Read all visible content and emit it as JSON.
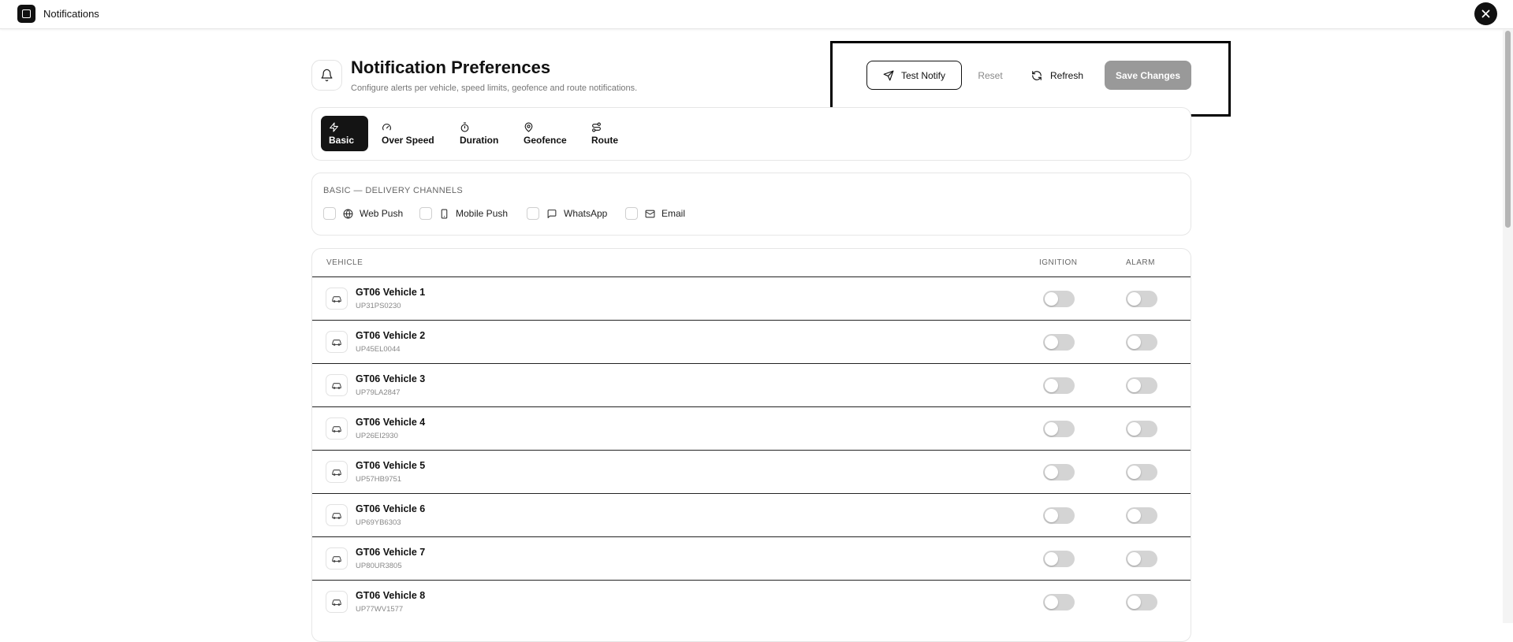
{
  "window": {
    "title": "Notifications"
  },
  "header": {
    "title": "Notification Preferences",
    "subtitle": "Configure alerts per vehicle, speed limits, geofence and route notifications."
  },
  "actions": {
    "test_notify": "Test Notify",
    "reset": "Reset",
    "refresh": "Refresh",
    "save": "Save Changes"
  },
  "tabs": [
    {
      "label": "Basic",
      "icon": "lightning-icon",
      "active": true
    },
    {
      "label": "Over Speed",
      "icon": "speedometer-icon",
      "active": false
    },
    {
      "label": "Duration",
      "icon": "stopwatch-icon",
      "active": false
    },
    {
      "label": "Geofence",
      "icon": "map-pin-icon",
      "active": false
    },
    {
      "label": "Route",
      "icon": "route-icon",
      "active": false
    }
  ],
  "channels": {
    "title": "BASIC — DELIVERY CHANNELS",
    "items": [
      {
        "label": "Web Push",
        "icon": "globe-icon",
        "checked": false
      },
      {
        "label": "Mobile Push",
        "icon": "phone-icon",
        "checked": false
      },
      {
        "label": "WhatsApp",
        "icon": "chat-icon",
        "checked": false
      },
      {
        "label": "Email",
        "icon": "mail-icon",
        "checked": false
      }
    ]
  },
  "table": {
    "headers": {
      "vehicle": "VEHICLE",
      "ignition": "IGNITION",
      "alarm": "ALARM"
    },
    "rows": [
      {
        "name": "GT06 Vehicle 1",
        "plate": "UP31PS0230",
        "ignition": false,
        "alarm": false
      },
      {
        "name": "GT06 Vehicle 2",
        "plate": "UP45EL0044",
        "ignition": false,
        "alarm": false
      },
      {
        "name": "GT06 Vehicle 3",
        "plate": "UP79LA2847",
        "ignition": false,
        "alarm": false
      },
      {
        "name": "GT06 Vehicle 4",
        "plate": "UP26EI2930",
        "ignition": false,
        "alarm": false
      },
      {
        "name": "GT06 Vehicle 5",
        "plate": "UP57HB9751",
        "ignition": false,
        "alarm": false
      },
      {
        "name": "GT06 Vehicle 6",
        "plate": "UP69YB6303",
        "ignition": false,
        "alarm": false
      },
      {
        "name": "GT06 Vehicle 7",
        "plate": "UP80UR3805",
        "ignition": false,
        "alarm": false
      },
      {
        "name": "GT06 Vehicle 8",
        "plate": "UP77WV1577",
        "ignition": false,
        "alarm": false
      }
    ]
  },
  "colors": {
    "primary": "#141414",
    "save_disabled": "#999999",
    "toggle_off": "#d4d4d4"
  }
}
